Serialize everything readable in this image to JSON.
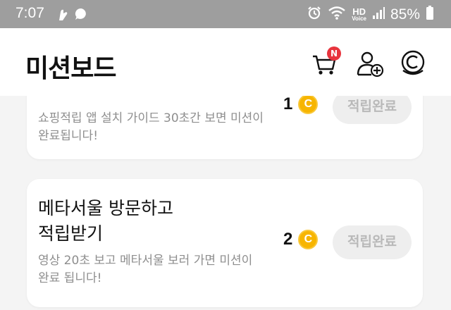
{
  "status_bar": {
    "time": "7:07",
    "hd_label": "HD",
    "hd_sub": "Voice",
    "battery": "85%",
    "icons": [
      "hand-notification-icon",
      "chat-bubble-icon",
      "alarm-icon",
      "wifi-icon",
      "hd-voice-icon",
      "signal-icon",
      "battery-icon"
    ]
  },
  "header": {
    "title": "미션보드",
    "cart_badge": "N",
    "coin_symbol": "C"
  },
  "missions": [
    {
      "title": "",
      "description": "쇼핑적립 앱 설치 가이드 30초간 보면 미션이\n완료됩니다!",
      "reward": "1",
      "coin_symbol": "C",
      "button_label": "적립완료"
    },
    {
      "title": "메타서울 방문하고\n적립받기",
      "description": "영상 20초 보고 메타서울 보러 가면 미션이\n완료 됩니다!",
      "reward": "2",
      "coin_symbol": "C",
      "button_label": "적립완료"
    }
  ],
  "colors": {
    "status_bar": "#9e9e9e",
    "badge": "#e8343d",
    "coin": "#f7b500",
    "button_bg": "#eeeeee",
    "button_text": "#b9b9b9"
  }
}
